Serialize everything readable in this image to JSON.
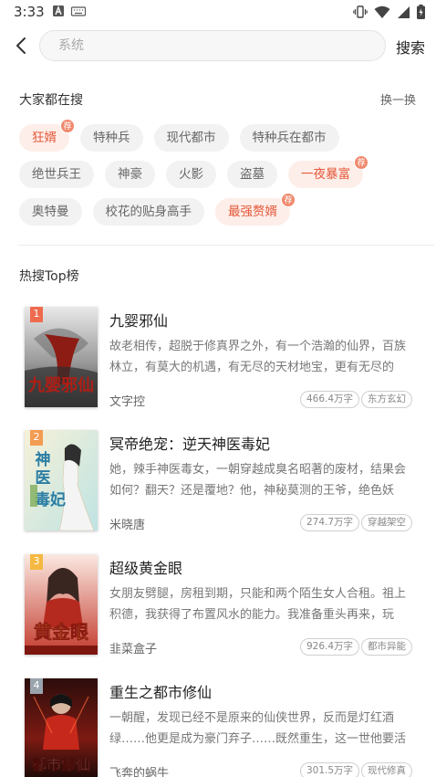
{
  "status_bar": {
    "time": "3:33"
  },
  "header": {
    "search_placeholder": "系统",
    "search_button": "搜索"
  },
  "hot_search": {
    "title": "大家都在搜",
    "refresh": "换一换",
    "badge_text": "荐",
    "rows": [
      [
        {
          "label": "狂婿",
          "hot": true
        },
        {
          "label": "特种兵",
          "hot": false
        },
        {
          "label": "现代都市",
          "hot": false
        },
        {
          "label": "特种兵在都市",
          "hot": false
        }
      ],
      [
        {
          "label": "绝世兵王",
          "hot": false
        },
        {
          "label": "神豪",
          "hot": false
        },
        {
          "label": "火影",
          "hot": false
        },
        {
          "label": "盗墓",
          "hot": false
        },
        {
          "label": "一夜暴富",
          "hot": true
        }
      ],
      [
        {
          "label": "奥特曼",
          "hot": false
        },
        {
          "label": "校花的贴身高手",
          "hot": false
        },
        {
          "label": "最强赘婿",
          "hot": true
        }
      ]
    ]
  },
  "top_list": {
    "title": "热搜Top榜",
    "books": [
      {
        "rank": "1",
        "title": "九婴邪仙",
        "desc": "故老相传，超脱于修真界之外，有一个浩瀚的仙界，百族林立，有莫大的机遇，有无尽的天材地宝，更有无尽的修…",
        "author": "文字控",
        "words": "466.4万字",
        "category": "东方玄幻",
        "rank_color": "#ef6b4f"
      },
      {
        "rank": "2",
        "title": "冥帝绝宠：逆天神医毒妃",
        "desc": "她，辣手神医毒女，一朝穿越成臭名昭著的废材，结果会如何？翻天？还是覆地？他，神秘莫测的王爷，绝色妖娆…",
        "author": "米晓唐",
        "words": "274.7万字",
        "category": "穿越架空",
        "rank_color": "#f39c53"
      },
      {
        "rank": "3",
        "title": "超级黄金眼",
        "desc": "女朋友劈腿，房租到期，只能和两个陌生女人合租。祖上积德，我获得了布置风水的能力。我准备重头再来，玩玩…",
        "author": "韭菜盒子",
        "words": "926.4万字",
        "category": "都市异能",
        "rank_color": "#f5b942"
      },
      {
        "rank": "4",
        "title": "重生之都市修仙",
        "desc": "一朝醒，发现已经不是原来的仙侠世界，反而是灯红酒绿……他更是成为豪门弃子……既然重生，这一世他要活的…",
        "author": "飞奔的蜗牛",
        "words": "301.5万字",
        "category": "现代修真",
        "rank_color": "#9aa4ad"
      }
    ]
  }
}
